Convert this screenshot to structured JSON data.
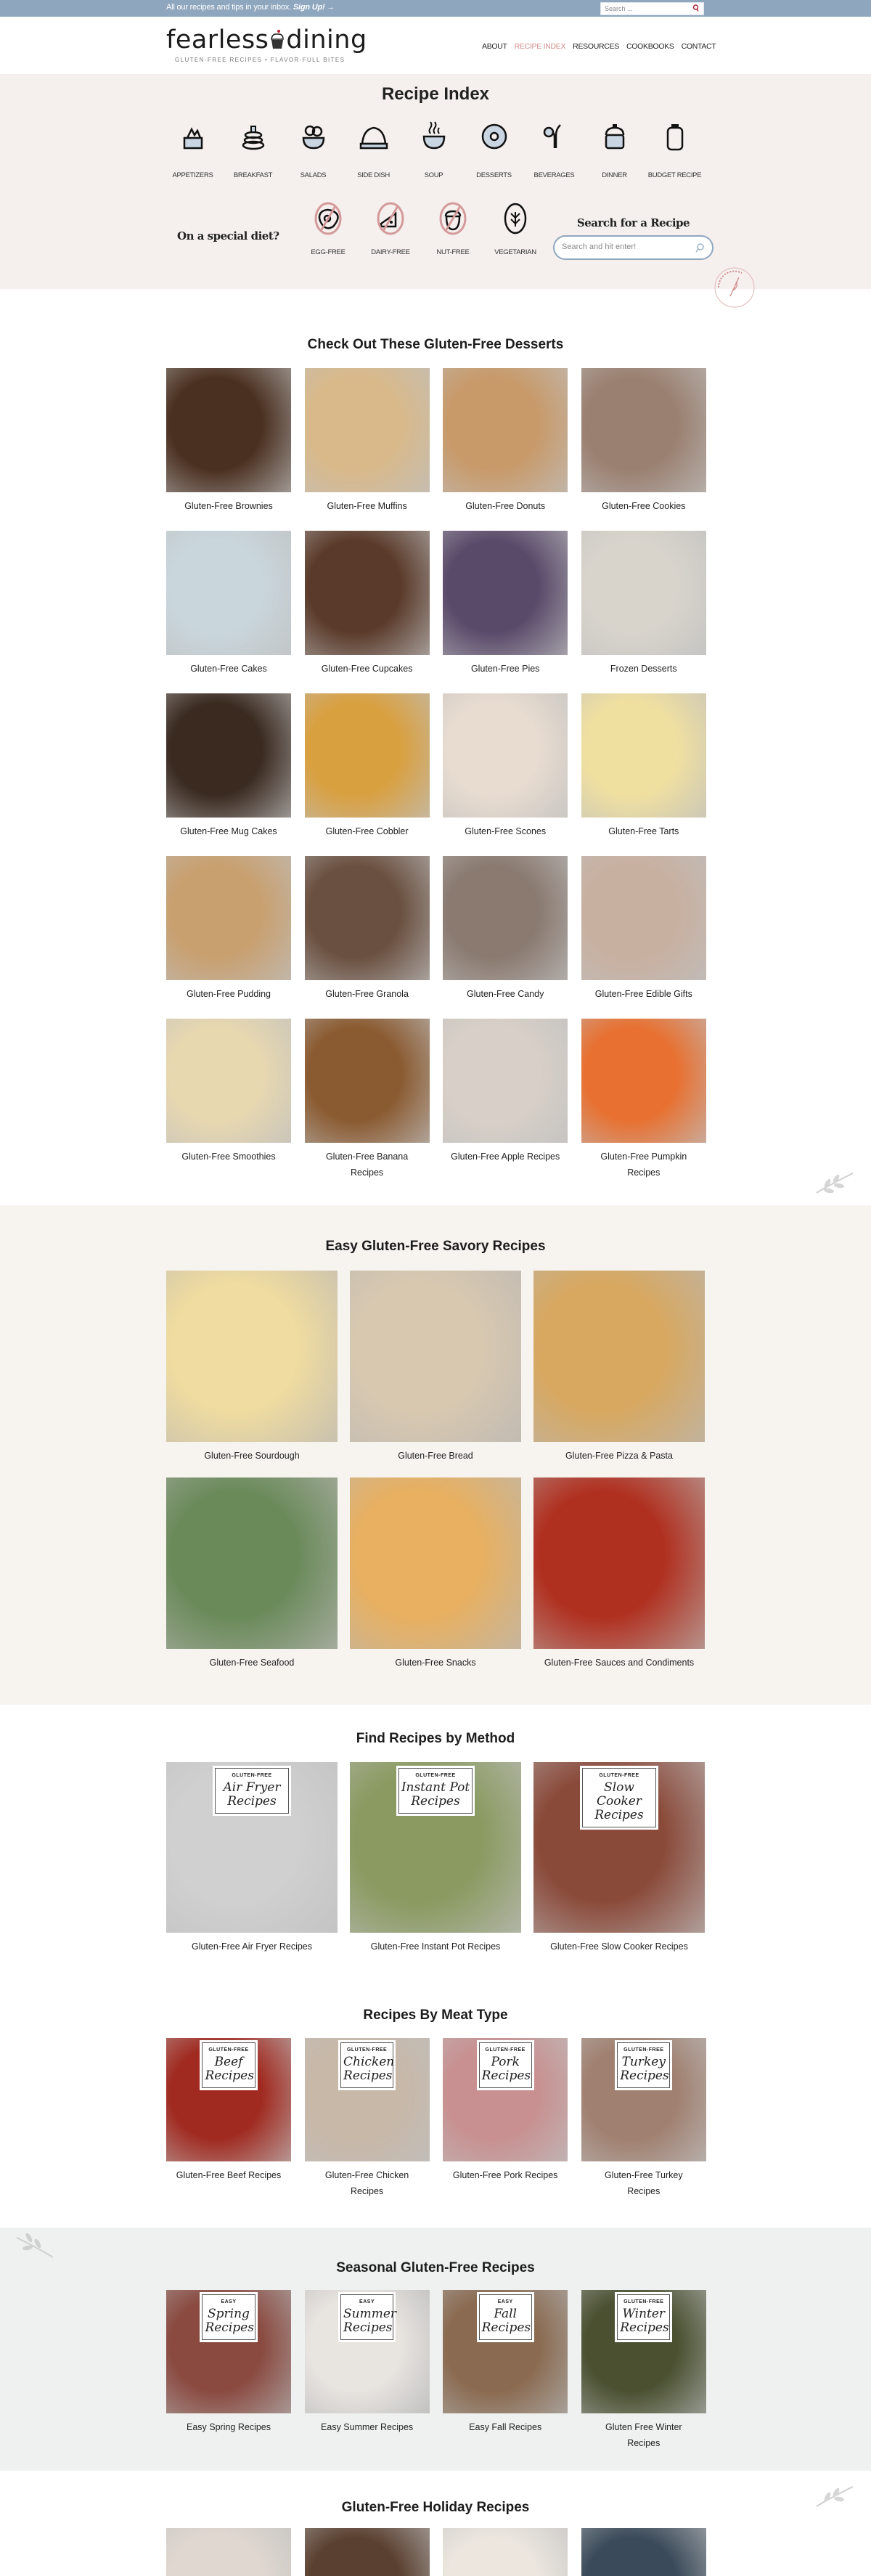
{
  "topbar": {
    "promo": "All our recipes and tips in your inbox.",
    "signup": "Sign Up!",
    "arrow": "→",
    "search_placeholder": "Search ..."
  },
  "brand": {
    "name_left": "fearless",
    "name_right": "dining",
    "tagline": "GLUTEN-FREE RECIPES • FLAVOR-FULL BITES",
    "stamp_text": "fearless dining"
  },
  "nav": [
    {
      "label": "ABOUT"
    },
    {
      "label": "RECIPE INDEX",
      "active": true
    },
    {
      "label": "RESOURCES"
    },
    {
      "label": "COOKBOOKS"
    },
    {
      "label": "CONTACT"
    }
  ],
  "colors": {
    "topbar": "#8fa6bf",
    "index_bg": "#f5f0ee",
    "accent": "#d18a8a",
    "savory_bg": "#f7f4f0",
    "seasonal_bg": "#eff1f1"
  },
  "index": {
    "title": "Recipe Index",
    "categories": [
      {
        "label": "APPETIZERS",
        "icon": "appetizer-bowl-icon"
      },
      {
        "label": "BREAKFAST",
        "icon": "pancakes-icon"
      },
      {
        "label": "SALADS",
        "icon": "salad-bowl-icon"
      },
      {
        "label": "SIDE DISH",
        "icon": "side-dish-icon"
      },
      {
        "label": "SOUP",
        "icon": "soup-bowl-icon"
      },
      {
        "label": "DESSERTS",
        "icon": "donut-icon"
      },
      {
        "label": "BEVERAGES",
        "icon": "beverage-icon"
      },
      {
        "label": "DINNER",
        "icon": "pot-icon"
      },
      {
        "label": "BUDGET RECIPE",
        "icon": "jar-icon"
      }
    ],
    "diet_question": "On a special diet?",
    "diets": [
      {
        "label": "EGG-FREE",
        "icon": "no-egg-icon"
      },
      {
        "label": "DAIRY-FREE",
        "icon": "no-cheese-icon"
      },
      {
        "label": "NUT-FREE",
        "icon": "no-nut-icon"
      },
      {
        "label": "VEGETARIAN",
        "icon": "leaf-icon"
      }
    ],
    "search_title": "Search for a Recipe",
    "search_placeholder": "Search and hit enter!"
  },
  "sections": {
    "desserts": {
      "title": "Check Out These Gluten-Free Desserts",
      "items": [
        {
          "label": "Gluten-Free Brownies",
          "color": "#4a3020"
        },
        {
          "label": "Gluten-Free Muffins",
          "color": "#d9b98a"
        },
        {
          "label": "Gluten-Free Donuts",
          "color": "#c89a6a"
        },
        {
          "label": "Gluten-Free Cookies",
          "color": "#9a8070"
        },
        {
          "label": "Gluten-Free Cakes",
          "color": "#c9d6dc"
        },
        {
          "label": "Gluten-Free Cupcakes",
          "color": "#5a3a2a"
        },
        {
          "label": "Gluten-Free Pies",
          "color": "#5a4a6a"
        },
        {
          "label": "Frozen Desserts",
          "color": "#d8d4cc"
        },
        {
          "label": "Gluten-Free Mug Cakes",
          "color": "#3a2a20"
        },
        {
          "label": "Gluten-Free Cobbler",
          "color": "#d9a040"
        },
        {
          "label": "Gluten-Free Scones",
          "color": "#e8dcd0"
        },
        {
          "label": "Gluten-Free Tarts",
          "color": "#f0e0a0"
        },
        {
          "label": "Gluten-Free Pudding",
          "color": "#c8a070"
        },
        {
          "label": "Gluten-Free Granola",
          "color": "#6a5040"
        },
        {
          "label": "Gluten-Free Candy",
          "color": "#8a7a70"
        },
        {
          "label": "Gluten-Free Edible Gifts",
          "color": "#c8b0a0"
        },
        {
          "label": "Gluten-Free Smoothies",
          "color": "#e8d8b0"
        },
        {
          "label": "Gluten-Free Banana Recipes",
          "color": "#8a5a30"
        },
        {
          "label": "Gluten-Free Apple Recipes",
          "color": "#d8d0c8"
        },
        {
          "label": "Gluten-Free Pumpkin Recipes",
          "color": "#e87030"
        }
      ]
    },
    "savory": {
      "title": "Easy Gluten-Free Savory Recipes",
      "items": [
        {
          "label": "Gluten-Free Sourdough",
          "color": "#f0dca0"
        },
        {
          "label": "Gluten-Free Bread",
          "color": "#d8c8b0"
        },
        {
          "label": "Gluten-Free Pizza & Pasta",
          "color": "#d8a860"
        },
        {
          "label": "Gluten-Free Seafood",
          "color": "#6a8a5a"
        },
        {
          "label": "Gluten-Free Snacks",
          "color": "#e8b060"
        },
        {
          "label": "Gluten-Free Sauces and Condiments",
          "color": "#b03020"
        }
      ]
    },
    "method": {
      "title": "Find Recipes by Method",
      "items": [
        {
          "label": "Gluten-Free Air Fryer Recipes",
          "color": "#d0d0d0",
          "card_top": "GLUTEN-FREE",
          "card_script": "Air Fryer Recipes"
        },
        {
          "label": "Gluten-Free Instant Pot Recipes",
          "color": "#8a9a60",
          "card_top": "GLUTEN-FREE",
          "card_script": "Instant Pot Recipes"
        },
        {
          "label": "Gluten-Free Slow Cooker Recipes",
          "color": "#8a4a3a",
          "card_top": "GLUTEN-FREE",
          "card_script": "Slow Cooker Recipes"
        }
      ]
    },
    "meat": {
      "title": "Recipes By Meat Type",
      "items": [
        {
          "label": "Gluten-Free Beef Recipes",
          "color": "#a02a20",
          "card_top": "GLUTEN-FREE",
          "card_script": "Beef Recipes"
        },
        {
          "label": "Gluten-Free Chicken Recipes",
          "color": "#c8b8a8",
          "card_top": "GLUTEN-FREE",
          "card_script": "Chicken Recipes"
        },
        {
          "label": "Gluten-Free Pork Recipes",
          "color": "#c89090",
          "card_top": "GLUTEN-FREE",
          "card_script": "Pork Recipes"
        },
        {
          "label": "Gluten-Free Turkey Recipes",
          "color": "#a08070",
          "card_top": "GLUTEN-FREE",
          "card_script": "Turkey Recipes"
        }
      ]
    },
    "seasonal": {
      "title": "Seasonal Gluten-Free Recipes",
      "items": [
        {
          "label": "Easy Spring Recipes",
          "color": "#8a4a40",
          "card_top": "EASY",
          "card_script": "Spring Recipes"
        },
        {
          "label": "Easy Summer Recipes",
          "color": "#e8e4e0",
          "card_top": "EASY",
          "card_script": "Summer Recipes"
        },
        {
          "label": "Easy Fall Recipes",
          "color": "#8a6a50",
          "card_top": "EASY",
          "card_script": "Fall Recipes"
        },
        {
          "label": "Gluten Free Winter Recipes",
          "color": "#4a5030",
          "card_top": "GLUTEN-FREE",
          "card_script": "Winter Recipes"
        }
      ]
    },
    "holiday": {
      "title": "Gluten-Free Holiday Recipes",
      "items": [
        {
          "color": "#e0d8d0"
        },
        {
          "color": "#5a4030"
        },
        {
          "color": "#ece6df"
        },
        {
          "color": "#3a4a5a"
        }
      ]
    }
  }
}
